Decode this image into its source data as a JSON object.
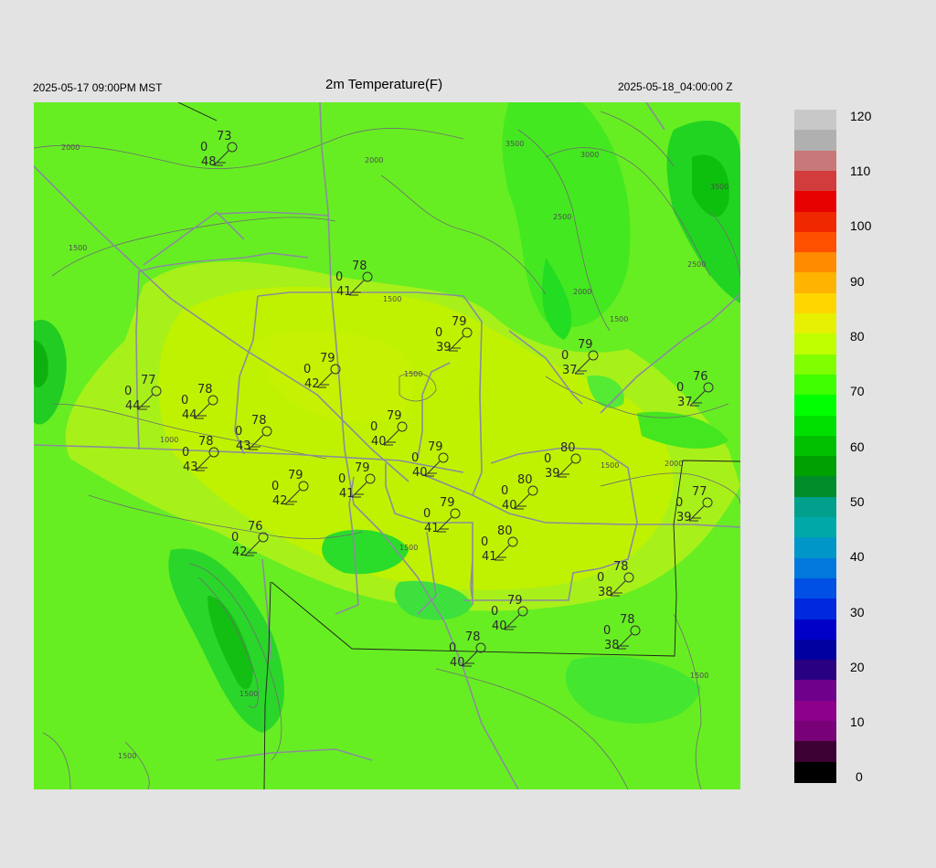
{
  "header": {
    "local_time": "2025-05-17 09:00PM MST",
    "title": "2m Temperature(F)",
    "valid_time": "2025-05-18_04:00:00 Z"
  },
  "colorbar": {
    "labels": [
      "120",
      "110",
      "100",
      "90",
      "80",
      "70",
      "60",
      "50",
      "40",
      "30",
      "20",
      "10",
      "0"
    ],
    "colors": [
      "#c8c8c8",
      "#b0b0b0",
      "#c87878",
      "#d23c3c",
      "#e60000",
      "#f02800",
      "#ff5000",
      "#ff8c00",
      "#ffb400",
      "#ffd700",
      "#e6f000",
      "#bfff00",
      "#7fff00",
      "#3fff00",
      "#00ff00",
      "#00e000",
      "#00c000",
      "#00a000",
      "#008c28",
      "#00a08c",
      "#00a8a8",
      "#0096c8",
      "#0078dc",
      "#0050e6",
      "#0028dc",
      "#0000c8",
      "#0000a0",
      "#280080",
      "#6e008c",
      "#8c008c",
      "#780078",
      "#3c0032",
      "#000000"
    ]
  },
  "contour_labels": [
    "2000",
    "1500",
    "1000",
    "1500",
    "1500",
    "1500",
    "2000",
    "2500",
    "3000",
    "3500",
    "2500",
    "2000",
    "1500",
    "1500",
    "3500",
    "1500",
    "2000",
    "1500",
    "1500"
  ],
  "stations": [
    {
      "temp": "73",
      "wind": "0",
      "dew": "48"
    },
    {
      "temp": "78",
      "wind": "0",
      "dew": "41"
    },
    {
      "temp": "79",
      "wind": "0",
      "dew": "39"
    },
    {
      "temp": "79",
      "wind": "0",
      "dew": "37"
    },
    {
      "temp": "79",
      "wind": "0",
      "dew": "42"
    },
    {
      "temp": "77",
      "wind": "0",
      "dew": "44"
    },
    {
      "temp": "78",
      "wind": "0",
      "dew": "44"
    },
    {
      "temp": "78",
      "wind": "0",
      "dew": "43"
    },
    {
      "temp": "78",
      "wind": "0",
      "dew": "43"
    },
    {
      "temp": "79",
      "wind": "0",
      "dew": "40"
    },
    {
      "temp": "76",
      "wind": "0",
      "dew": "37"
    },
    {
      "temp": "79",
      "wind": "0",
      "dew": "40"
    },
    {
      "temp": "80",
      "wind": "0",
      "dew": "39"
    },
    {
      "temp": "79",
      "wind": "0",
      "dew": "41"
    },
    {
      "temp": "79",
      "wind": "0",
      "dew": "42"
    },
    {
      "temp": "80",
      "wind": "0",
      "dew": "40"
    },
    {
      "temp": "77",
      "wind": "0",
      "dew": "39"
    },
    {
      "temp": "79",
      "wind": "0",
      "dew": "41"
    },
    {
      "temp": "76",
      "wind": "0",
      "dew": "42"
    },
    {
      "temp": "80",
      "wind": "0",
      "dew": "41"
    },
    {
      "temp": "78",
      "wind": "0",
      "dew": "38"
    },
    {
      "temp": "79",
      "wind": "0",
      "dew": "40"
    },
    {
      "temp": "78",
      "wind": "0",
      "dew": "38"
    },
    {
      "temp": "78",
      "wind": "0",
      "dew": "40"
    }
  ]
}
